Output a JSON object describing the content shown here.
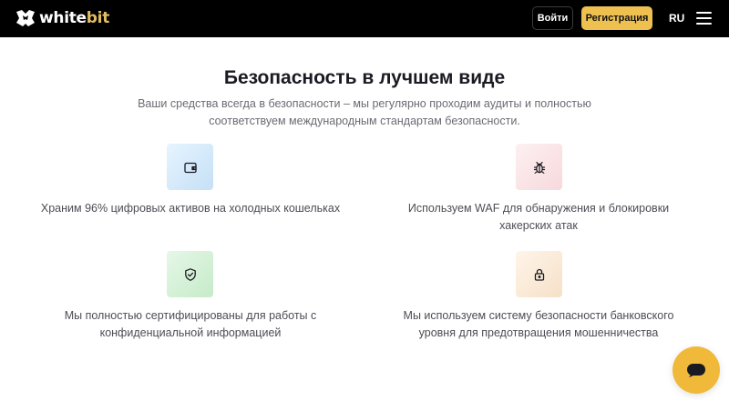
{
  "header": {
    "logo": {
      "text_main": "white",
      "text_accent": "bit",
      "icon": "whitebit-logo-icon"
    },
    "login_label": "Войти",
    "register_label": "Регистрация",
    "language": "RU",
    "menu_icon": "hamburger-menu-icon"
  },
  "colors": {
    "header_bg": "#000000",
    "accent": "#eec050",
    "logo_accent": "#e2bd60",
    "chat_button": "#f0b93a"
  },
  "section": {
    "title": "Безопасность в лучшем виде",
    "subtitle": "Ваши средства всегда в безопасности – мы регулярно проходим аудиты и полностью соответствуем международным стандартам безопасности."
  },
  "features": [
    {
      "icon": "wallet-icon",
      "text": "Храним 96% цифровых активов на холодных кошельках"
    },
    {
      "icon": "bug-icon",
      "text": "Используем WAF для обнаружения и блокировки хакерских атак"
    },
    {
      "icon": "shield-check-icon",
      "text": "Мы полностью сертифицированы для работы с конфиденциальной информацией"
    },
    {
      "icon": "lock-icon",
      "text": "Мы используем систему безопасности банковского уровня для предотвращения мошенничества"
    }
  ],
  "chat_widget": {
    "icon": "chat-icon"
  }
}
